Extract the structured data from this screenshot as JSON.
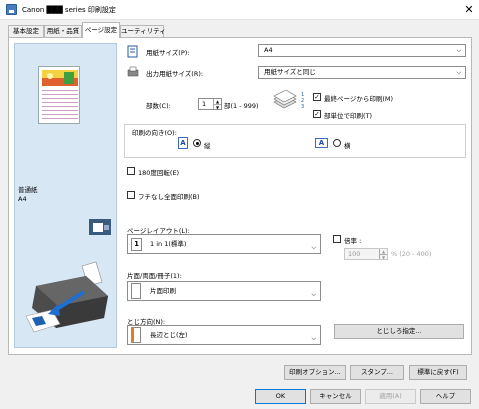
{
  "window": {
    "title": "Canon ███ series 印刷設定",
    "close_glyph": "✕"
  },
  "tabs": [
    "基本設定",
    "用紙・品質",
    "ページ設定",
    "ユーティリティ"
  ],
  "preview": {
    "media_type": "普通紙",
    "paper_size": "A4"
  },
  "fields": {
    "paper_size_label": "用紙サイズ(P):",
    "paper_size_value": "A4",
    "output_size_label": "出力用紙サイズ(R):",
    "output_size_value": "用紙サイズと同じ",
    "copies_label": "部数(C):",
    "copies_value": "1",
    "copies_range": "部(1 - 999)",
    "print_from_last_label": "最終ページから印刷(M)",
    "print_from_last_checked": true,
    "collate_label": "部単位で印刷(T)",
    "collate_checked": true,
    "orientation_label": "印刷の向き(O):",
    "portrait_label": "縦",
    "landscape_label": "横",
    "orientation_selected": "portrait",
    "rotate180_label": "180度回転(E)",
    "rotate180_checked": false,
    "borderless_label": "フチなし全面印刷(B)",
    "borderless_checked": false,
    "page_layout_label": "ページレイアウト(L):",
    "page_layout_value": "1 in 1(標準)",
    "scale_label": "倍率 :",
    "scale_checked": false,
    "scale_value": "100",
    "scale_range": "% (20 - 400)",
    "duplex_label": "片面/両面/冊子(1):",
    "duplex_value": "片面印刷",
    "binding_label": "とじ方向(N):",
    "binding_value": "長辺とじ(左)",
    "margin_button": "とじしろ指定..."
  },
  "panel_buttons": {
    "print_options": "印刷オプション...",
    "stamp": "スタンプ...",
    "defaults": "標準に戻す(F)"
  },
  "dialog_buttons": {
    "ok": "OK",
    "cancel": "キャンセル",
    "apply": "適用(A)",
    "help": "ヘルプ"
  },
  "icons": {
    "app": "printer-app-icon",
    "paper_size": "paper-size-icon",
    "output_size": "printer-paper-icon",
    "copies": "stacked-pages-icon",
    "collate": "collate-order-icon",
    "portrait": "portrait-icon",
    "landscape": "landscape-icon",
    "page_layout": "one-in-one-icon",
    "duplex": "one-sided-icon",
    "binding": "binding-left-icon",
    "printer": "printer-illustration-icon"
  }
}
